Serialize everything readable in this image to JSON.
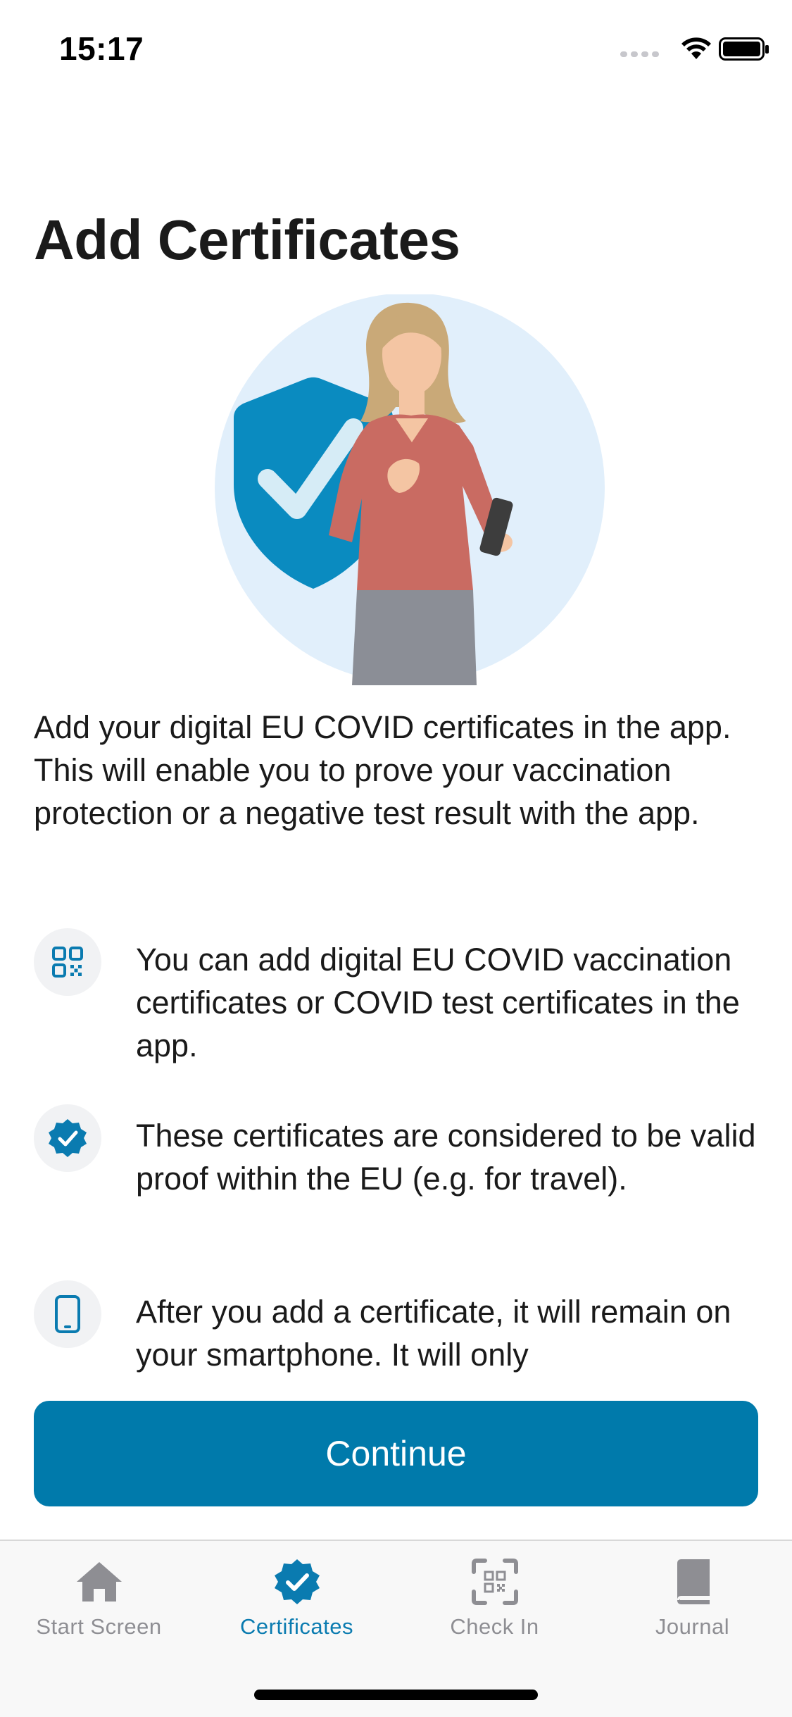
{
  "status_bar": {
    "time": "15:17"
  },
  "page": {
    "title": "Add Certificates",
    "intro": "Add your digital EU COVID certificates in the app. This will enable you to prove your vaccination protection or a negative test result with the app."
  },
  "bullets": [
    {
      "icon": "qr-code-icon",
      "text": "You can add digital EU COVID vaccination certificates or COVID test certificates in the app."
    },
    {
      "icon": "verified-badge-icon",
      "text": "These certificates are considered to be valid proof within the EU (e.g. for travel)."
    },
    {
      "icon": "smartphone-icon",
      "text": "After you add a certificate, it will remain on your smartphone. It will only"
    }
  ],
  "actions": {
    "continue_label": "Continue"
  },
  "tab_bar": {
    "active": "Certificates",
    "tabs": [
      {
        "label": "Start Screen",
        "icon": "home-icon"
      },
      {
        "label": "Certificates",
        "icon": "certificate-badge-icon"
      },
      {
        "label": "Check In",
        "icon": "qr-scan-icon"
      },
      {
        "label": "Journal",
        "icon": "book-icon"
      }
    ]
  },
  "colors": {
    "accent": "#007aab",
    "active_tab": "#0a7bb0",
    "inactive_tab": "#8e8e93",
    "shield": "#0a8bc0",
    "hero_circle": "#e1effb"
  }
}
